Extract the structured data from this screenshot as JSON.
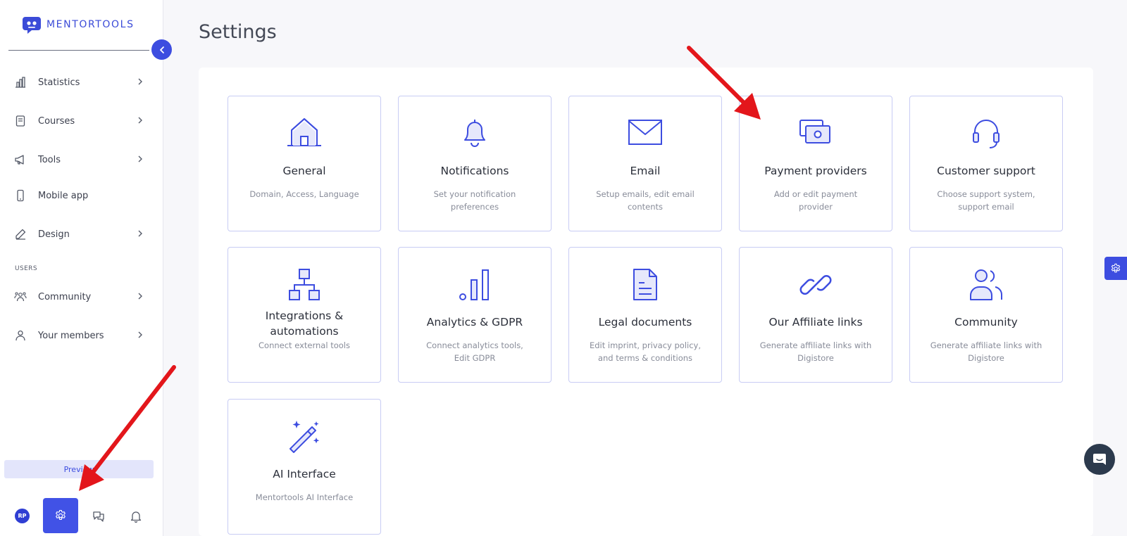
{
  "brand": {
    "name": "MENTORTOOLS",
    "accent": "#3d4de0"
  },
  "sidebar": {
    "items": [
      {
        "label": "Statistics",
        "icon": "bar-chart-icon",
        "chevron": true
      },
      {
        "label": "Courses",
        "icon": "book-icon",
        "chevron": true
      },
      {
        "label": "Tools",
        "icon": "megaphone-icon",
        "chevron": true
      },
      {
        "label": "Mobile app",
        "icon": "mobile-icon",
        "chevron": false
      },
      {
        "label": "Design",
        "icon": "pencil-icon",
        "chevron": true
      }
    ],
    "section_users": "USERS",
    "user_items": [
      {
        "label": "Community",
        "icon": "community-icon",
        "chevron": true
      },
      {
        "label": "Your members",
        "icon": "person-icon",
        "chevron": true
      }
    ],
    "preview_label": "Preview",
    "avatar_initials": "RP"
  },
  "main": {
    "title": "Settings",
    "cards": [
      {
        "title": "General",
        "desc": "Domain, Access, Language",
        "icon": "home-icon"
      },
      {
        "title": "Notifications",
        "desc": "Set your notification preferences",
        "icon": "bell-icon"
      },
      {
        "title": "Email",
        "desc": "Setup emails, edit email contents",
        "icon": "envelope-icon"
      },
      {
        "title": "Payment providers",
        "desc": "Add or edit payment provider",
        "icon": "money-icon"
      },
      {
        "title": "Customer support",
        "desc": "Choose support system, support email",
        "icon": "headset-icon"
      },
      {
        "title": "Integrations & automations",
        "desc": "Connect external tools",
        "icon": "hierarchy-icon"
      },
      {
        "title": "Analytics & GDPR",
        "desc": "Connect analytics tools, Edit GDPR",
        "icon": "analytics-icon"
      },
      {
        "title": "Legal documents",
        "desc": "Edit imprint, privacy policy, and terms & conditions",
        "icon": "document-icon"
      },
      {
        "title": "Our Affiliate links",
        "desc": "Generate affiliate links with Digistore",
        "icon": "link-icon"
      },
      {
        "title": "Community",
        "desc": "Generate affiliate links with Digistore",
        "icon": "users-icon"
      },
      {
        "title": "AI Interface",
        "desc": "Mentortools AI Interface",
        "icon": "magic-wand-icon"
      }
    ]
  }
}
